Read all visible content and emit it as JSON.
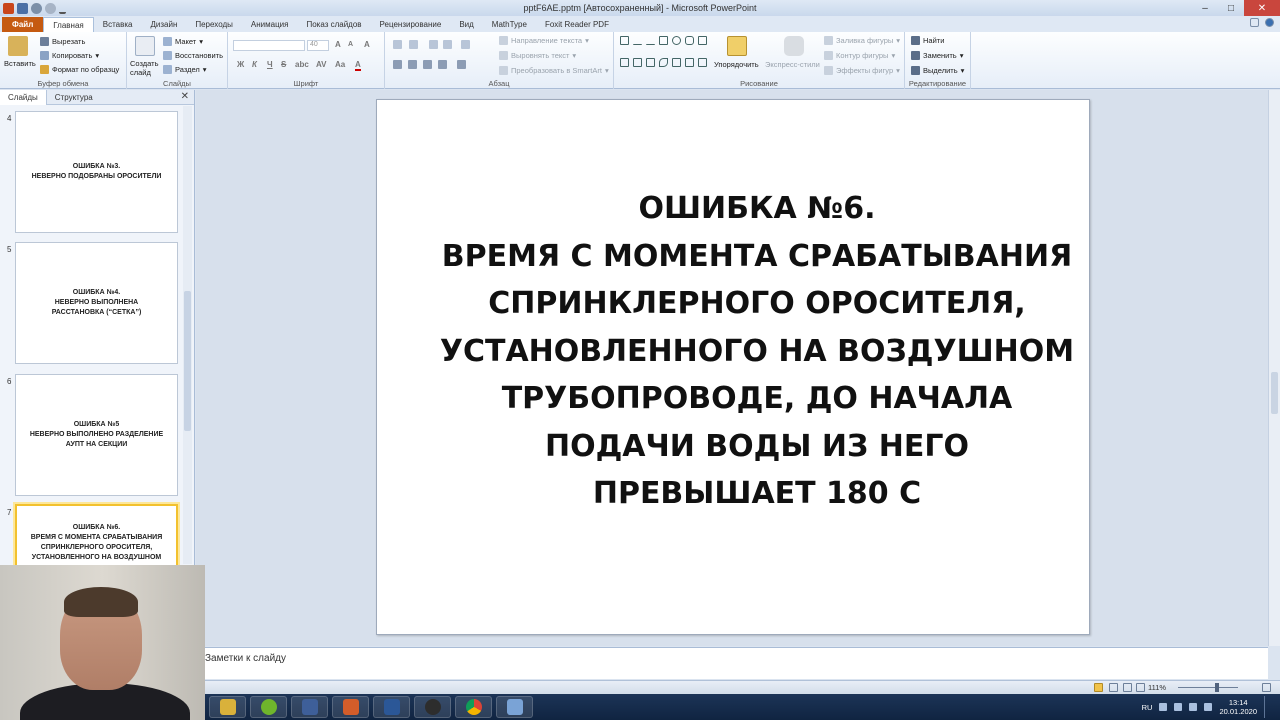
{
  "window": {
    "title": "pptF6AE.pptm [Автосохраненный] - Microsoft PowerPoint"
  },
  "tabs": [
    "Файл",
    "Главная",
    "Вставка",
    "Дизайн",
    "Переходы",
    "Анимация",
    "Показ слайдов",
    "Рецензирование",
    "Вид",
    "MathType",
    "Foxit Reader PDF"
  ],
  "ribbon": {
    "clipboard": {
      "label": "Буфер обмена",
      "paste": "Вставить",
      "cut": "Вырезать",
      "copy": "Копировать",
      "format_painter": "Формат по образцу"
    },
    "slides": {
      "label": "Слайды",
      "new_slide": "Создать слайд",
      "layout": "Макет",
      "reset": "Восстановить",
      "section": "Раздел"
    },
    "font": {
      "label": "Шрифт",
      "size": "40",
      "bold": "Ж",
      "italic": "К",
      "underline": "Ч",
      "strike": "S"
    },
    "paragraph": {
      "label": "Абзац",
      "text_direction": "Направление текста",
      "align_text": "Выровнять текст",
      "convert_smartart": "Преобразовать в SmartArt"
    },
    "drawing": {
      "label": "Рисование",
      "arrange": "Упорядочить",
      "quick_styles": "Экспресс-стили",
      "shape_fill": "Заливка фигуры",
      "shape_outline": "Контур фигуры",
      "shape_effects": "Эффекты фигур"
    },
    "editing": {
      "label": "Редактирование",
      "find": "Найти",
      "replace": "Заменить",
      "select": "Выделить"
    }
  },
  "left_panel": {
    "tabs": [
      "Слайды",
      "Структура"
    ],
    "slides": [
      {
        "number": "4",
        "text": "ОШИБКА №3.\nНЕВЕРНО ПОДОБРАНЫ ОРОСИТЕЛИ"
      },
      {
        "number": "5",
        "text": "ОШИБКА №4.\nНЕВЕРНО ВЫПОЛНЕНА\nРАССТАНОВКА (“СЕТКА”)"
      },
      {
        "number": "6",
        "text": "ОШИБКА №5\nНЕВЕРНО ВЫПОЛНЕНО РАЗДЕЛЕНИЕ\nАУПТ НА СЕКЦИИ"
      },
      {
        "number": "7",
        "text": "ОШИБКА №6.\nВРЕМЯ С МОМЕНТА СРАБАТЫВАНИЯ\nСПРИНКЛЕРНОГО ОРОСИТЕЛЯ,\nУСТАНОВЛЕННОГО НА ВОЗДУШНОМ"
      }
    ]
  },
  "slide": {
    "text": "ОШИБКА №6.\nВРЕМЯ С МОМЕНТА СРАБАТЫВАНИЯ\nСПРИНКЛЕРНОГО ОРОСИТЕЛЯ,\nУСТАНОВЛЕННОГО НА ВОЗДУШНОМ\nТРУБОПРОВОДЕ, ДО НАЧАЛА\nПОДАЧИ ВОДЫ ИЗ НЕГО\nПРЕВЫШАЕТ 180 С"
  },
  "notes": {
    "placeholder": "Заметки к слайду"
  },
  "status": {
    "zoom": "111%"
  },
  "taskbar": {
    "language": "RU",
    "time": "13:14",
    "date": "20.01.2020"
  },
  "colors": {
    "file_tab": "#c55a11",
    "selection": "#f2c12e",
    "taskbar": "#102441"
  }
}
